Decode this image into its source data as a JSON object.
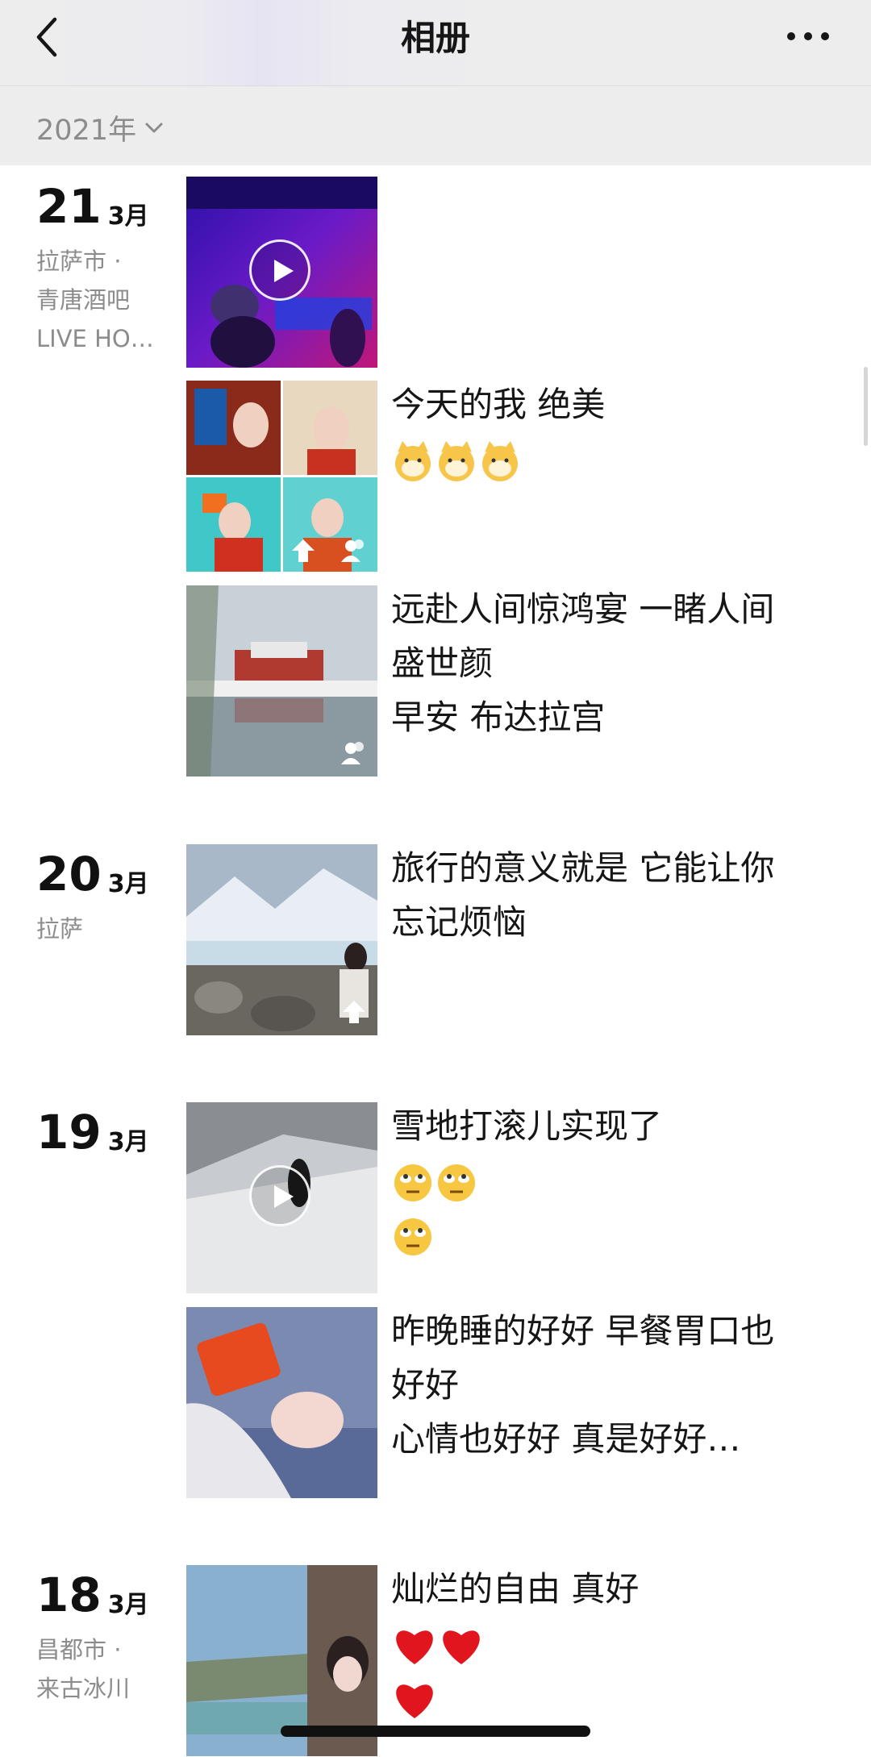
{
  "header": {
    "title": "相册",
    "back_icon": "chevron-left-icon",
    "more_icon": "more-dots-icon"
  },
  "year_selector": {
    "label": "2021年",
    "icon": "chevron-down-icon"
  },
  "groups": [
    {
      "day": "21",
      "month": "3月",
      "location": [
        "拉萨市 ·",
        "青唐酒吧",
        "LIVE HO…"
      ],
      "posts": [
        {
          "caption": [],
          "media": "video"
        },
        {
          "caption": [
            "今天的我  绝美"
          ],
          "emoji": [
            "cat-face",
            "cat-face",
            "cat-face"
          ],
          "media": "photo-grid"
        },
        {
          "caption": [
            "远赴人间惊鸿宴 一睹人间",
            "盛世颜",
            "早安 布达拉宫"
          ],
          "media": "photo"
        }
      ]
    },
    {
      "day": "20",
      "month": "3月",
      "location": [
        "拉萨"
      ],
      "posts": [
        {
          "caption": [
            "旅行的意义就是 它能让你",
            "忘记烦恼"
          ],
          "media": "photo"
        }
      ]
    },
    {
      "day": "19",
      "month": "3月",
      "location": [],
      "posts": [
        {
          "caption": [
            "雪地打滚儿实现了"
          ],
          "emoji": [
            "eye-roll-face",
            "eye-roll-face",
            "eye-roll-face"
          ],
          "media": "video"
        },
        {
          "caption": [
            "昨晚睡的好好 早餐胃口也",
            "好好",
            "心情也好好  真是好好…"
          ],
          "media": "photo"
        }
      ]
    },
    {
      "day": "18",
      "month": "3月",
      "location": [
        "昌都市 ·",
        "来古冰川"
      ],
      "posts": [
        {
          "caption": [
            "灿烂的自由 真好"
          ],
          "emoji": [
            "red-heart",
            "red-heart",
            "red-heart"
          ],
          "media": "photo"
        }
      ]
    }
  ],
  "colors": {
    "nav_bg": "#ededed",
    "secondary_text": "#8c8c8c",
    "primary_text": "#161616"
  }
}
